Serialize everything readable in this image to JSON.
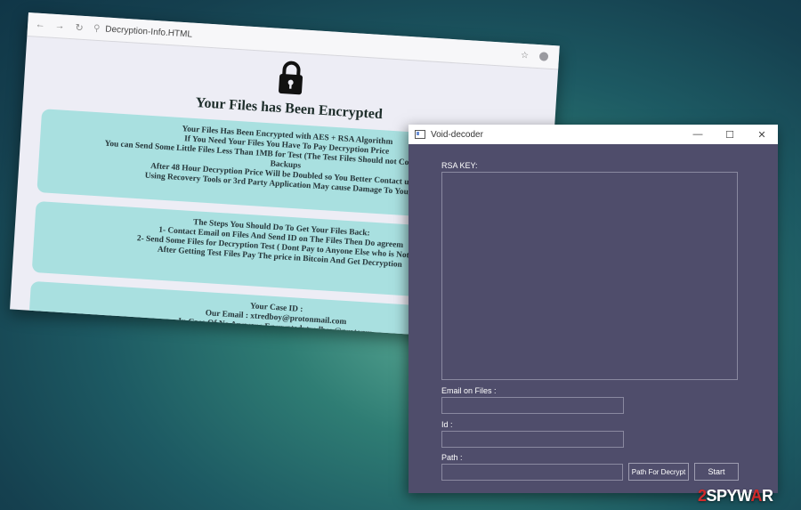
{
  "browser": {
    "url": "Decryption-Info.HTML",
    "title": "Your Files has Been Encrypted",
    "box1_lines": [
      "Your Files Has Been Encrypted with AES + RSA Algorithm",
      "If You Need Your Files You Have To Pay Decryption Price",
      "You can Send Some Little Files Less Than 1MB for Test (The Test Files Should not Contain valuable D",
      "Backups",
      "After 48 Hour Decryption Price Will be Doubled so You Better Contact us F",
      "Using Recovery Tools or 3rd Party Application May cause Damage To Your Fil"
    ],
    "box2_lines": [
      "The Steps You Should Do To Get Your Files Back:",
      "1- Contact Email on Files And Send ID on The Files Then Do agreem",
      "2- Send Some Files for Decryption Test ( Dont Pay to Anyone Else who is Not Abl",
      "After Getting Test Files Pay The price in Bitcoin And Get Decryption"
    ],
    "box3_lines": [
      "Your Case ID :",
      "Our Email : xtredboy@protonmail.com",
      "In Case Of No Answer : Encryptedxtredboy@protonm"
    ]
  },
  "decoder": {
    "title": "Void-decoder",
    "rsa_label": "RSA KEY:",
    "email_label": "Email on Files :",
    "id_label": "Id :",
    "path_label": "Path :",
    "path_button": "Path For Decrypt",
    "start_button": "Start",
    "minimize": "—",
    "maximize": "☐",
    "close": "✕"
  },
  "watermark": {
    "two": "2",
    "spyw": "SPYW",
    "a": "A",
    "r": "R"
  },
  "icons": [
    "back-icon",
    "forward-icon",
    "reload-icon",
    "search-icon",
    "star-icon",
    "lock-icon",
    "app-icon"
  ]
}
